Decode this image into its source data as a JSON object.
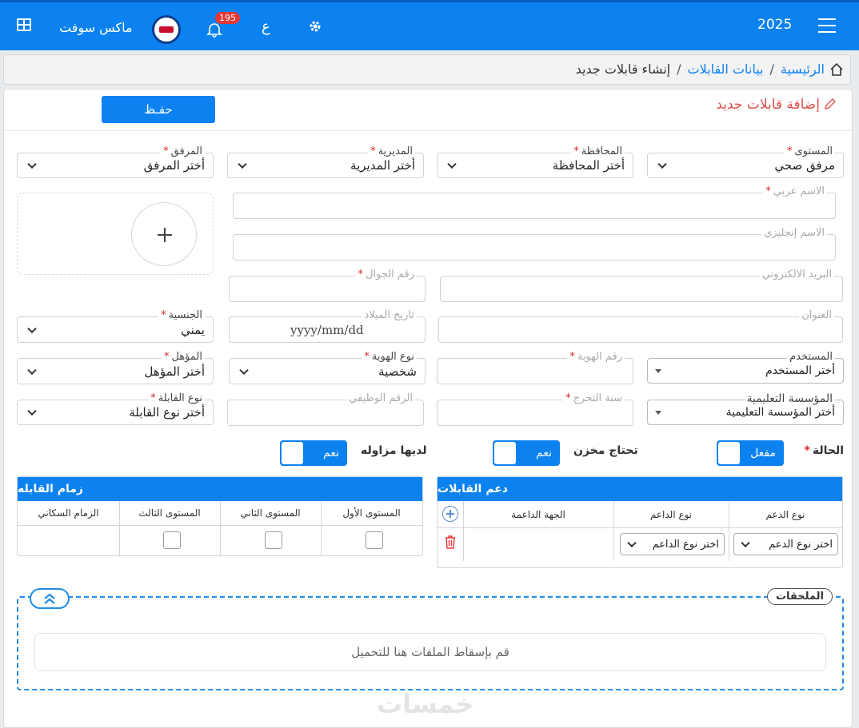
{
  "topbar": {
    "year": "2025",
    "company": "ماكس سوفت",
    "lang": "ع",
    "notification_count": "195",
    "menu_icon": "hamburger-icon",
    "grid_icon": "grid-icon",
    "settings_icon": "gear-icon",
    "bell_icon": "bell-icon"
  },
  "breadcrumb": {
    "home": "الرئيسية",
    "section": "بيانات القابلات",
    "current": "إنشاء قابلات جديد",
    "sep": "/"
  },
  "form": {
    "title": "إضافة قابلات جديد",
    "save_label": "حفـظ",
    "level": {
      "label": "المستوى",
      "value": "مرفق صحي"
    },
    "governorate": {
      "label": "المحافظة",
      "value": "أختر المحافظة"
    },
    "directorate": {
      "label": "المديرية",
      "value": "أختر المديرية"
    },
    "facility": {
      "label": "المرفق",
      "value": "أختر المرفق"
    },
    "name_ar": {
      "label": "الاسم عربي"
    },
    "name_en": {
      "label": "الاسم إنجليزي"
    },
    "email": {
      "label": "البريد الالكتروني"
    },
    "mobile": {
      "label": "رقم الجوال"
    },
    "address": {
      "label": "العنوان"
    },
    "birth_date": {
      "label": "تاريخ الميلاد",
      "placeholder": "yyyy/mm/dd"
    },
    "nationality": {
      "label": "الجنسية",
      "value": "يمني"
    },
    "user": {
      "label": "المستخدم",
      "value": "أختر المستخدم"
    },
    "id_number": {
      "label": "رقم الهوية"
    },
    "id_type": {
      "label": "نوع الهوية",
      "value": "شخصية"
    },
    "qualification": {
      "label": "المؤهل",
      "value": "أختر المؤهل"
    },
    "institution": {
      "label": "المؤسسة التعليمية",
      "value": "أختر المؤسسة التعليمية"
    },
    "grad_year": {
      "label": "سنة التخرج"
    },
    "job_number": {
      "label": "الرقم الوظيفي"
    },
    "midwife_type": {
      "label": "نوع القابلة",
      "value": "أختر نوع القابلة"
    },
    "status": {
      "label": "الحالة",
      "toggle": "مفعل"
    },
    "needs_store": {
      "label": "تحتاج مخزن",
      "toggle": "نعم"
    },
    "has_practice": {
      "label": "لديها مزاوله",
      "toggle": "نعم"
    },
    "photo_icon": "plus-icon"
  },
  "support": {
    "title": "دعم القابلات",
    "columns": [
      "نوع الدعم",
      "نوع الداعم",
      "الجهة الداعمة"
    ],
    "row": {
      "support_type": "اختر نوع الدعم",
      "supporter_type": "اختر نوع الداعم"
    }
  },
  "reins": {
    "title": "زمام القابله",
    "columns": [
      "المستوى الأول",
      "المستوى الثاني",
      "المستوى الثالث",
      "الزمام السكاني"
    ]
  },
  "attachments": {
    "title": "الملحقات",
    "dropzone": "قم بإسقاط الملفات هنا للتحميل"
  },
  "watermark": "خمسات",
  "colors": {
    "primary": "#0b82f0",
    "title_red": "#e0504a",
    "required": "#e02424"
  }
}
